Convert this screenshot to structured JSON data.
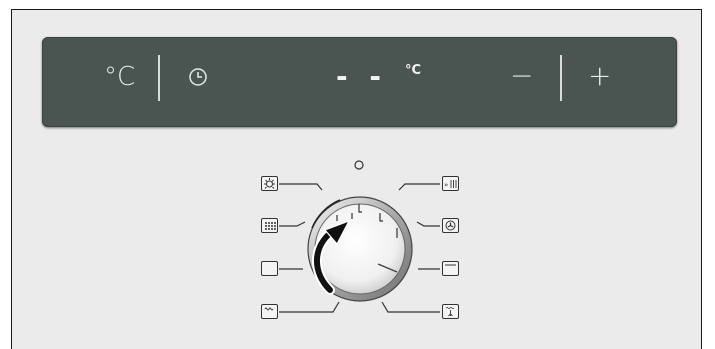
{
  "display": {
    "temp_unit_button": "°C",
    "display_dashes": "- -",
    "display_unit": "°C",
    "minus_button": "−",
    "plus_button": "+"
  },
  "dial": {
    "modes": [
      "off",
      "lamp",
      "grill-fan",
      "top-bottom-heat",
      "fan-ring",
      "conventional",
      "bottom-heat",
      "fan-top",
      "defrost"
    ]
  }
}
